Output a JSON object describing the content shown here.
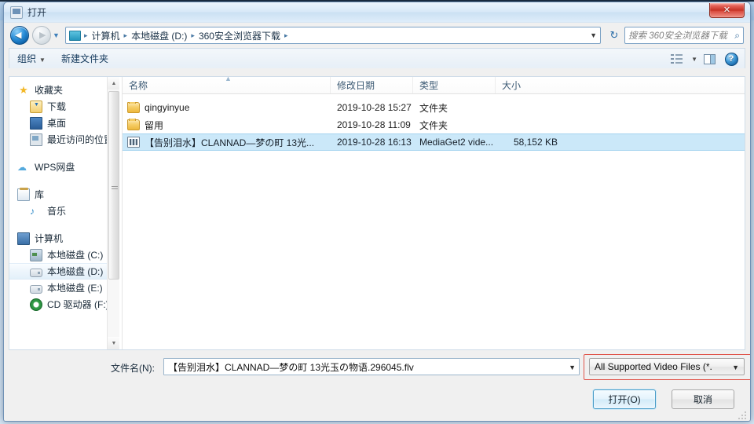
{
  "window": {
    "title": "打开",
    "title_icon": "open-folder-icon",
    "close_label": "✕"
  },
  "address": {
    "back_icon": "back-arrow-icon",
    "forward_icon": "forward-arrow-icon",
    "history_icon": "chevron-down-icon",
    "folder_icon": "folder-icon",
    "breadcrumbs": [
      "计算机",
      "本地磁盘 (D:)",
      "360安全浏览器下载"
    ],
    "separator": "▸",
    "dropdown_icon": "chevron-down-icon",
    "refresh_icon": "refresh-icon",
    "refresh_glyph": "↻"
  },
  "search": {
    "placeholder": "搜索 360安全浏览器下载",
    "icon": "search-icon",
    "glyph": "⌕"
  },
  "toolbar": {
    "organize_label": "组织",
    "organize_caret": "▼",
    "new_folder_label": "新建文件夹",
    "views_icon": "view-mode-icon",
    "views_caret": "▼",
    "preview_pane_icon": "preview-pane-icon",
    "help_icon": "help-icon",
    "help_glyph": "?"
  },
  "sidebar": {
    "groups": [
      {
        "header": {
          "label": "收藏夹",
          "icon": "star-icon",
          "icon_class": "i-star",
          "glyph": "★"
        },
        "items": [
          {
            "label": "下载",
            "icon": "downloads-icon",
            "icon_class": "i-dl",
            "glyph": ""
          },
          {
            "label": "桌面",
            "icon": "desktop-icon",
            "icon_class": "i-desk",
            "glyph": ""
          },
          {
            "label": "最近访问的位置",
            "icon": "recent-places-icon",
            "icon_class": "i-recent",
            "glyph": ""
          }
        ]
      },
      {
        "header": {
          "label": "WPS网盘",
          "icon": "cloud-icon",
          "icon_class": "i-cloud",
          "glyph": "☁"
        },
        "items": []
      },
      {
        "header": {
          "label": "库",
          "icon": "library-icon",
          "icon_class": "i-lib",
          "glyph": ""
        },
        "items": [
          {
            "label": "音乐",
            "icon": "music-icon",
            "icon_class": "i-music",
            "glyph": "♪"
          }
        ]
      },
      {
        "header": {
          "label": "计算机",
          "icon": "computer-icon",
          "icon_class": "i-pc",
          "glyph": ""
        },
        "items": [
          {
            "label": "本地磁盘 (C:)",
            "icon": "system-drive-icon",
            "icon_class": "i-hddsys",
            "glyph": "",
            "selected": false
          },
          {
            "label": "本地磁盘 (D:)",
            "icon": "drive-icon",
            "icon_class": "i-hdd",
            "glyph": "",
            "selected": true
          },
          {
            "label": "本地磁盘 (E:)",
            "icon": "drive-icon",
            "icon_class": "i-hdd",
            "glyph": "",
            "selected": false
          },
          {
            "label": "CD 驱动器 (F:) H",
            "icon": "cd-drive-icon",
            "icon_class": "i-cd",
            "glyph": "",
            "selected": false
          }
        ]
      }
    ],
    "scrollbar": {
      "up_glyph": "▲",
      "down_glyph": "▼"
    }
  },
  "file_list": {
    "columns": [
      {
        "key": "name",
        "label": "名称"
      },
      {
        "key": "date",
        "label": "修改日期"
      },
      {
        "key": "type",
        "label": "类型"
      },
      {
        "key": "size",
        "label": "大小"
      }
    ],
    "sort_indicator": "▲",
    "rows": [
      {
        "name": "qingyinyue",
        "date": "2019-10-28 15:27",
        "type": "文件夹",
        "size": "",
        "icon": "folder-icon",
        "icon_class": "folder-ico",
        "selected": false
      },
      {
        "name": "留用",
        "date": "2019-10-28 11:09",
        "type": "文件夹",
        "size": "",
        "icon": "folder-icon",
        "icon_class": "folder-ico",
        "selected": false
      },
      {
        "name": "【告别泪水】CLANNAD—梦の町 13光...",
        "date": "2019-10-28 16:13",
        "type": "MediaGet2 vide...",
        "size": "58,152 KB",
        "icon": "video-file-icon",
        "icon_class": "media-ico",
        "selected": true
      }
    ]
  },
  "bottom": {
    "filename_label": "文件名(N):",
    "filename_value": "【告别泪水】CLANNAD—梦の町 13光玉の物语.296045.flv",
    "filename_dropdown_icon": "chevron-down-icon",
    "filetype_value": "All Supported Video Files (*.",
    "filetype_dropdown_icon": "chevron-down-icon",
    "open_button": "打开(O)",
    "cancel_button": "取消",
    "highlight_color": "#e0544a"
  },
  "colors": {
    "selection": "#cbe8f9",
    "accent": "#2a8ed8",
    "close_red": "#c32f22"
  }
}
